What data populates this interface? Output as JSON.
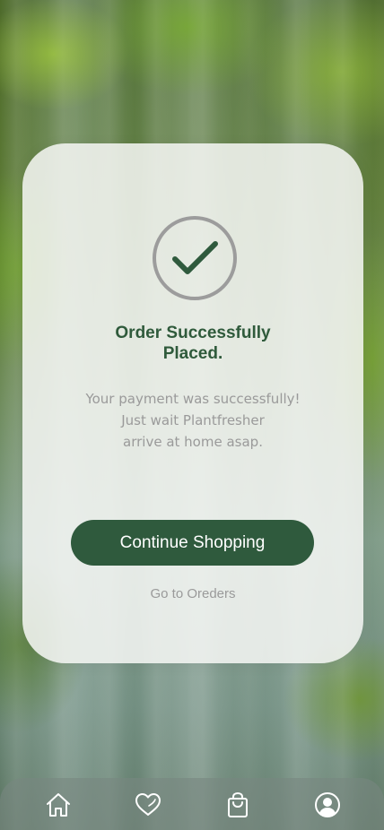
{
  "colors": {
    "primary": "#2f5a3d",
    "title": "#2f5a3b",
    "muted_text": "#9a9a9a",
    "check_ring": "#9c9c9c",
    "card_background": "#f6f7f5"
  },
  "success_card": {
    "icon": "check-circle-icon",
    "title_line1": "Order Successfully",
    "title_line2": "Placed.",
    "message_line1": "Your payment was successfully!",
    "message_line2": "Just wait Plantfresher",
    "message_line3": "arrive at home asap.",
    "primary_button_label": "Continue Shopping",
    "secondary_link_label": "Go to Oreders"
  },
  "bottom_nav": {
    "items": [
      {
        "icon": "home-icon"
      },
      {
        "icon": "heart-icon"
      },
      {
        "icon": "shopping-bag-icon"
      },
      {
        "icon": "profile-icon"
      }
    ]
  }
}
